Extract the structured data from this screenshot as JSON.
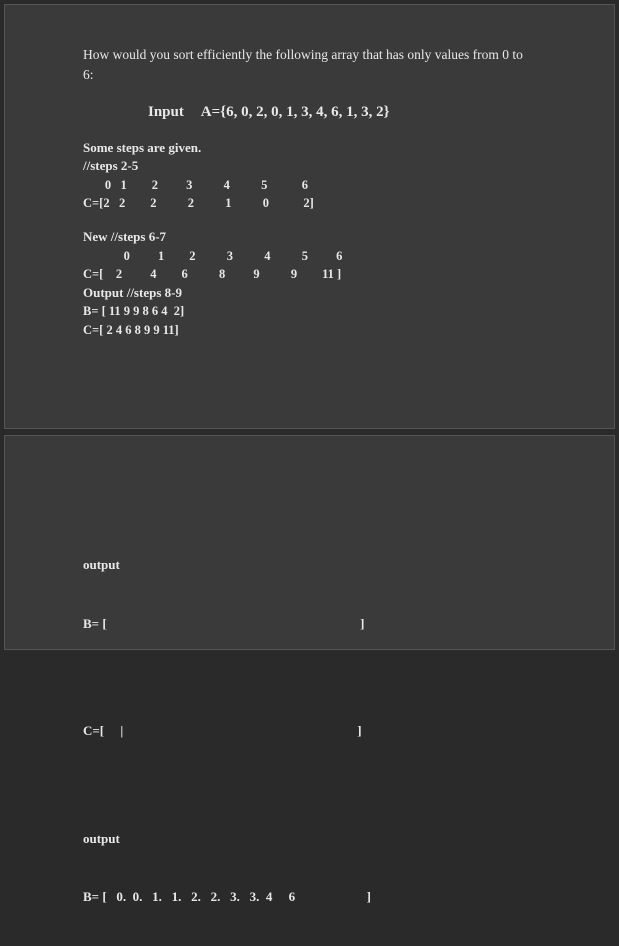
{
  "top": {
    "intro": "How would you sort efficiently the following array that has only values from 0 to 6:",
    "input_label": "Input",
    "input_value": "A={6, 0, 2, 0, 1, 3, 4, 6, 1, 3, 2}",
    "line1": "Some steps are given.",
    "line2": "//steps 2-5",
    "idx_row1": "       0   1        2         3          4          5           6",
    "c_row1": "C=[2   2        2          2          1          0           2]",
    "line3": "New  //steps 6-7",
    "idx_row2": "             0         1        2          3          4          5         6",
    "c_row2": "C=[    2         4        6          8         9          9        11 ]",
    "line4": "Output //steps 8-9",
    "b_row": "B= [ 11 9 9 8 6 4  2]",
    "c_row3": "C=[ 2 4 6 8 9 9 11]"
  },
  "bottom": {
    "out1_label": "output",
    "b1": "B= [                                                                              ]",
    "c1": "C=[     |                                                                        ]",
    "out2_label": "output",
    "b2": "B= [   0.  0.   1.   1.   2.   2.   3.   3.  4     6                      ]"
  }
}
